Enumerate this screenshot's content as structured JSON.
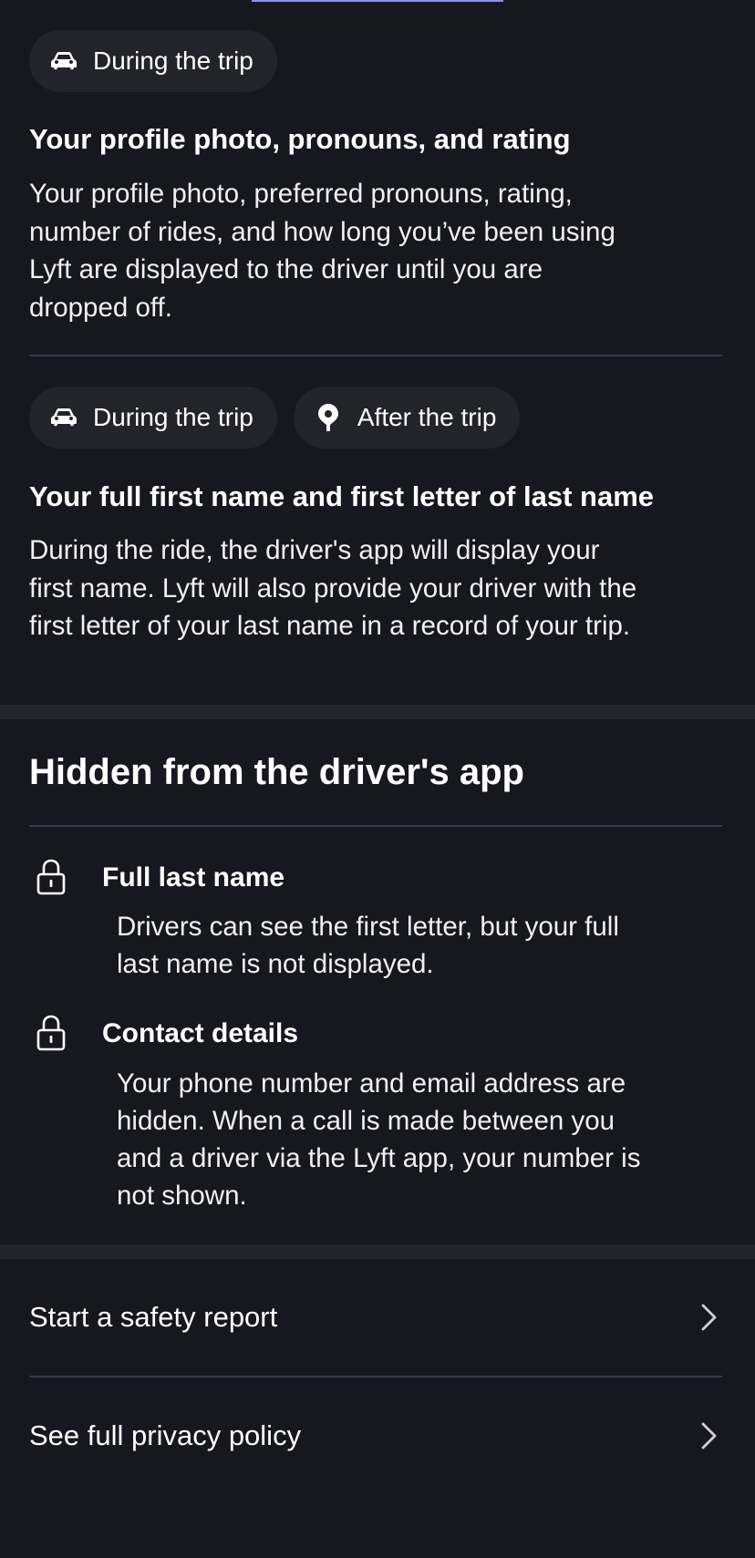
{
  "chips": {
    "during": "During the trip",
    "after": "After the trip"
  },
  "cards": [
    {
      "title": "Your profile photo, pronouns, and rating",
      "body_lines": [
        "Your profile photo, preferred pronouns, rating,",
        "number of rides, and how long you’ve been using",
        "Lyft are displayed to the driver until you are",
        "dropped off."
      ]
    },
    {
      "title": "Your full first name and first letter of last name",
      "body_lines": [
        "During the ride, the driver's app will display your",
        "first name. Lyft will also provide your driver with the",
        "first letter of your last name in a record of your trip."
      ]
    }
  ],
  "hidden": {
    "heading": "Hidden from the driver's app",
    "items": [
      {
        "title": "Full last name",
        "body_lines": [
          "Drivers can see the first letter, but your full",
          "last name is not displayed."
        ]
      },
      {
        "title": "Contact details",
        "body_lines": [
          "Your phone number and email address are",
          "hidden. When a call is made between you",
          "and a driver via the Lyft app, your number is",
          "not shown."
        ]
      }
    ]
  },
  "links": {
    "safety_report": "Start a safety report",
    "privacy_policy": "See full privacy policy"
  },
  "colors": {
    "background": "#17171f",
    "chip_background": "#23232c",
    "divider": "#3a3a44",
    "section_band": "#24242d",
    "text": "#ffffff"
  },
  "icons": {
    "chip_during": "car-icon",
    "chip_after": "location-pin-icon",
    "hidden_item": "lock-icon",
    "row_arrow": "chevron-right-icon"
  }
}
